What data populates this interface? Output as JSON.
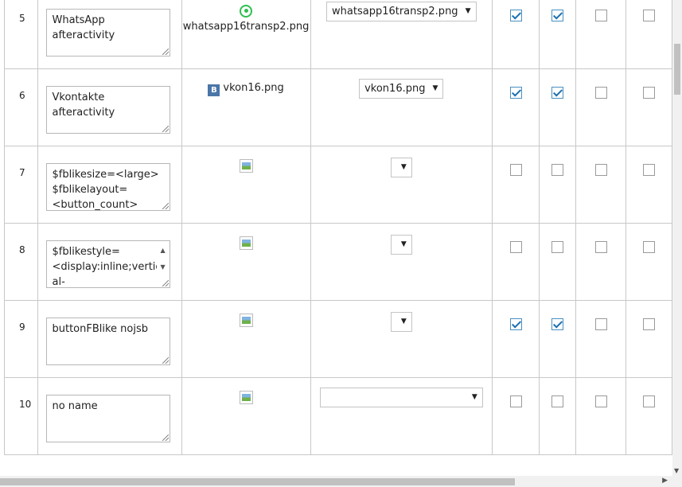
{
  "rows": [
    {
      "num": "5",
      "name": "WhatsApp afteractivity",
      "image_file": "whatsapp16transp2.png",
      "icon": "whatsapp-icon",
      "select_value": "whatsapp16transp2.png",
      "checks": [
        true,
        true,
        false,
        false
      ]
    },
    {
      "num": "6",
      "name": "Vkontakte afteractivity",
      "image_file": "vkon16.png",
      "icon": "vk-icon",
      "icon_text": "B",
      "select_value": "vkon16.png",
      "checks": [
        true,
        true,
        false,
        false
      ]
    },
    {
      "num": "7",
      "name": "$fblikesize=<large>\n$fblikelayout=\n<button_count>",
      "image_file": "",
      "icon": "broken-image-icon",
      "select_value": "",
      "checks": [
        false,
        false,
        false,
        false
      ]
    },
    {
      "num": "8",
      "name": "$fblikestyle=\n<display:inline;vertic\nal-",
      "image_file": "",
      "icon": "broken-image-icon",
      "select_value": "",
      "checks": [
        false,
        false,
        false,
        false
      ]
    },
    {
      "num": "9",
      "name": "buttonFBlike nojsb",
      "image_file": "",
      "icon": "broken-image-icon",
      "select_value": "",
      "checks": [
        true,
        true,
        false,
        false
      ]
    },
    {
      "num": "10",
      "name": "no name",
      "image_file": "",
      "icon": "broken-image-icon",
      "select_value": "",
      "checks": [
        false,
        false,
        false,
        false
      ]
    }
  ],
  "colors": {
    "check_accent": "#1a6fb0",
    "whatsapp_green": "#2fbf4f",
    "vk_blue": "#4a76a8"
  }
}
